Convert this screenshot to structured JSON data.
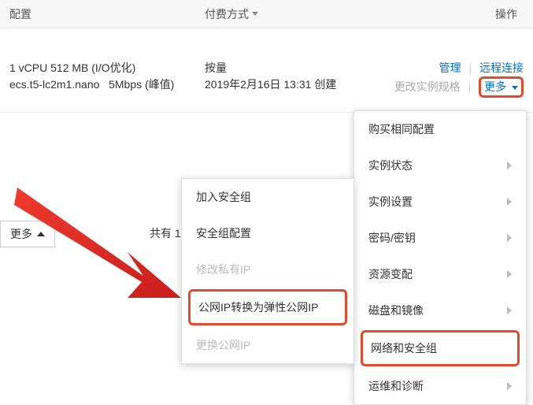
{
  "header": {
    "config": "配置",
    "payment": "付费方式",
    "operations": "操作"
  },
  "row": {
    "cpu_mem": "1 vCPU 512 MB (I/O优化)",
    "instance_type": "ecs.t5-lc2m1.nano",
    "bandwidth": "5Mbps (峰值)",
    "bill_mode": "按量",
    "created": "2019年2月16日 13:31 创建",
    "ops": {
      "manage": "管理",
      "remote": "远程连接",
      "change_spec": "更改实例规格",
      "more": "更多"
    }
  },
  "lower_more": "更多",
  "total_prefix": "共有 1",
  "menu_right": {
    "buy_same": "购买相同配置",
    "instance_status": "实例状态",
    "instance_settings": "实例设置",
    "password_key": "密码/密钥",
    "resource_change": "资源变配",
    "disk_image": "磁盘和镜像",
    "network_security": "网络和安全组",
    "ops_diag": "运维和诊断"
  },
  "menu_left": {
    "join_sg": "加入安全组",
    "sg_config": "安全组配置",
    "modify_private_ip": "修改私有IP",
    "convert_eip": "公网IP转换为弹性公网IP",
    "change_public_ip": "更换公网IP"
  }
}
